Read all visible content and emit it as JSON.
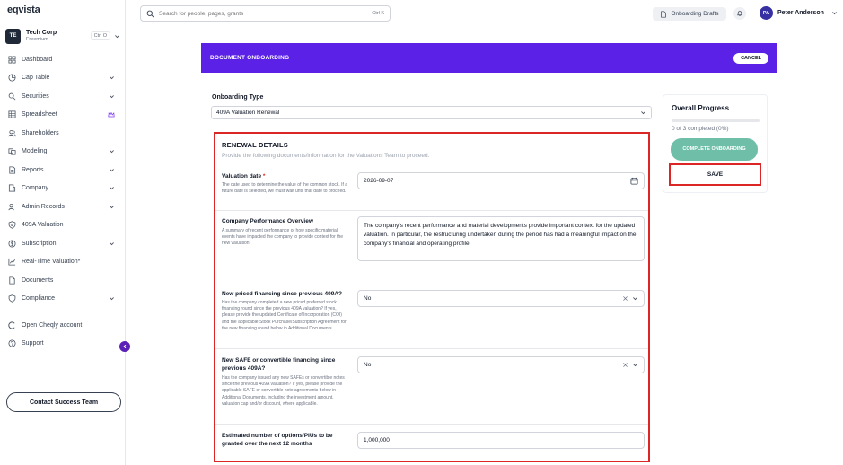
{
  "app": {
    "logo": "eqvista"
  },
  "org": {
    "initials": "TE",
    "name": "Tech Corp",
    "plan": "Freemium",
    "shortcut": "Ctrl O"
  },
  "sidebar": {
    "items": [
      {
        "label": "Dashboard",
        "icon": "grid-icon",
        "chevron": false
      },
      {
        "label": "Cap Table",
        "icon": "pie-icon",
        "chevron": true
      },
      {
        "label": "Securities",
        "icon": "security-icon",
        "chevron": true
      },
      {
        "label": "Spreadsheet",
        "icon": "spreadsheet-icon",
        "crown": true
      },
      {
        "label": "Shareholders",
        "icon": "users-icon",
        "chevron": false
      },
      {
        "label": "Modeling",
        "icon": "modeling-icon",
        "chevron": true
      },
      {
        "label": "Reports",
        "icon": "reports-icon",
        "chevron": true
      },
      {
        "label": "Company",
        "icon": "company-icon",
        "chevron": true
      },
      {
        "label": "Admin Records",
        "icon": "admin-icon",
        "chevron": true
      },
      {
        "label": "409A Valuation",
        "icon": "shield-check-icon",
        "chevron": false
      },
      {
        "label": "Subscription",
        "icon": "subscription-icon",
        "chevron": true
      },
      {
        "label": "Real-Time Valuation*",
        "icon": "chart-line-icon",
        "chevron": false
      },
      {
        "label": "Documents",
        "icon": "document-icon",
        "chevron": false
      },
      {
        "label": "Compliance",
        "icon": "compliance-icon",
        "chevron": true
      }
    ],
    "extra": [
      {
        "label": "Open Cheqly account",
        "icon": "cheqly-icon"
      },
      {
        "label": "Support",
        "icon": "help-icon"
      }
    ],
    "contact_label": "Contact Success Team"
  },
  "topbar": {
    "search_placeholder": "Search for people, pages, grants",
    "search_shortcut": "Ctrl K",
    "drafts_label": "Onboarding Drafts",
    "user_initials": "PA",
    "user_name": "Peter Anderson"
  },
  "banner": {
    "title": "DOCUMENT ONBOARDING",
    "cancel_label": "CANCEL"
  },
  "onboarding_type": {
    "label": "Onboarding Type",
    "value": "409A Valuation Renewal"
  },
  "renewal": {
    "title": "RENEWAL DETAILS",
    "subtitle": "Provide the following documents/information for the Valuations Team to proceed.",
    "valuation_date": {
      "label": "Valuation date",
      "required": "*",
      "desc": "The date used to determine the value of the common stock. If a future date is selected, we must wait until that date to proceed.",
      "value": "2026-09-07"
    },
    "performance": {
      "label": "Company Performance Overview",
      "desc": "A summary of recent performance or how specific material events have impacted the company to provide context for the new valuation.",
      "value": "The company's recent performance and material developments provide important context for the updated valuation. In particular, the restructuring undertaken during the period has had a meaningful impact on the company's financial and operating profile."
    },
    "priced_financing": {
      "label": "New priced financing since previous 409A?",
      "desc": "Has the company completed a new priced preferred stock financing round since the previous 409A valuation? If yes, please provide the updated Certificate of Incorporation (COI) and the applicable Stock Purchase/Subscription Agreement for the new financing round below in Additional Documents.",
      "value": "No"
    },
    "safe_financing": {
      "label": "New SAFE or convertible financing since previous 409A?",
      "desc": "Has the company issued any new SAFEs or convertible notes since the previous 409A valuation? If yes, please provide the applicable SAFE or convertible note agreements below in Additional Documents, including the investment amount, valuation cap and/or discount, where applicable.",
      "value": "No"
    },
    "options": {
      "label": "Estimated number of options/PIUs to be granted over the next 12 months",
      "value": "1,000,000"
    }
  },
  "progress": {
    "title": "Overall Progress",
    "fraction": 0,
    "count_text": "0 of 3 completed (0%)",
    "complete_label": "COMPLETE ONBOARDING",
    "save_label": "SAVE",
    "accent": "#5b21e6",
    "complete_color": "#6fbfa8"
  }
}
